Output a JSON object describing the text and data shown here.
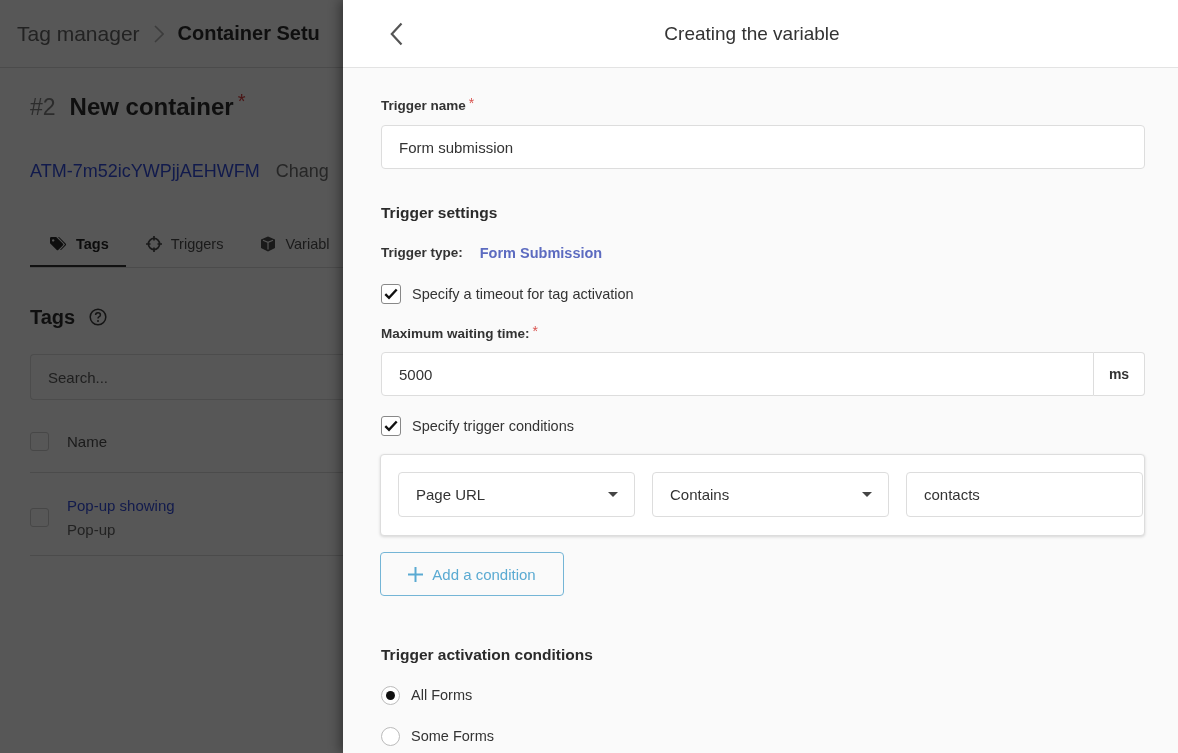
{
  "background_page": {
    "breadcrumb": [
      {
        "label": "Tag manager",
        "current": false
      },
      {
        "label": "Container Setu",
        "current": true
      }
    ],
    "container": {
      "number": "#2",
      "name": "New container",
      "required_mark": "*"
    },
    "container_id": "ATM-7m52icYWPjjAEHWFM",
    "container_status": "Chang",
    "tabs": [
      {
        "label": "Tags",
        "selected": true
      },
      {
        "label": "Triggers",
        "selected": false
      },
      {
        "label": "Variabl",
        "selected": false
      }
    ],
    "section": {
      "title": "Tags"
    },
    "search": {
      "placeholder": "Search..."
    },
    "table": {
      "columns": [
        "Name"
      ],
      "select_all": {
        "checked": false
      },
      "rows": [
        {
          "name": "Pop-up showing",
          "type": "Pop-up",
          "checked": false
        }
      ]
    }
  },
  "panel": {
    "title": "Creating the variable",
    "trigger_name": {
      "label": "Trigger name",
      "required_mark": "*",
      "value": "Form submission"
    },
    "settings_heading": "Trigger settings",
    "trigger_type": {
      "label": "Trigger type:",
      "value": "Form Submission"
    },
    "timeout_option": {
      "label": "Specify a timeout for tag activation",
      "checked": true
    },
    "max_wait": {
      "label": "Maximum waiting time:",
      "required_mark": "*",
      "value": "5000",
      "unit": "ms"
    },
    "conditions_option": {
      "label": "Specify trigger conditions",
      "checked": true
    },
    "conditions": [
      {
        "variable": "Page URL",
        "operator": "Contains",
        "value": "contacts"
      }
    ],
    "add_condition": {
      "label": "Add a condition"
    },
    "activation": {
      "heading": "Trigger activation conditions",
      "options": [
        {
          "label": "All Forms",
          "selected": true
        },
        {
          "label": "Some Forms",
          "selected": false
        }
      ]
    }
  }
}
